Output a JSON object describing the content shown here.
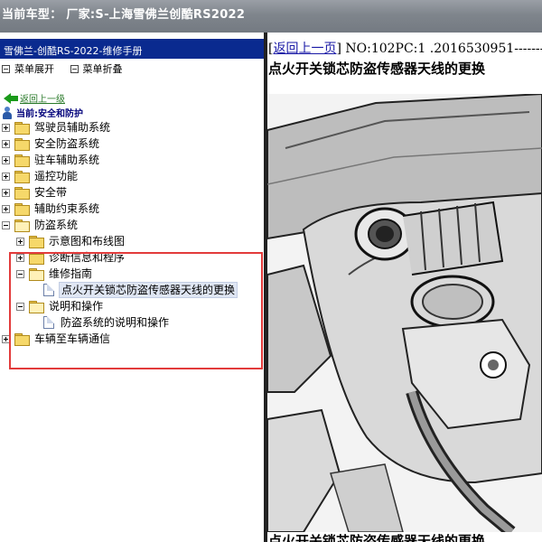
{
  "window": {
    "title": "当前车型：  厂家:S-上海雪佛兰创酷RS2022"
  },
  "left": {
    "header": "雪佛兰-创酷RS-2022-维修手册",
    "tools": {
      "expand_label": "菜单展开",
      "collapse_label": "菜单折叠"
    },
    "back_label": "返回上一级",
    "current_label": "当前:安全和防护"
  },
  "tree": {
    "items": [
      {
        "label": "驾驶员辅助系统",
        "expander": "plus",
        "icon": "folder",
        "level": 0
      },
      {
        "label": "安全防盗系统",
        "expander": "plus",
        "icon": "folder",
        "level": 0
      },
      {
        "label": "驻车辅助系统",
        "expander": "plus",
        "icon": "folder",
        "level": 0
      },
      {
        "label": "遥控功能",
        "expander": "plus",
        "icon": "folder",
        "level": 0
      },
      {
        "label": "安全带",
        "expander": "plus",
        "icon": "folder",
        "level": 0
      },
      {
        "label": "辅助约束系统",
        "expander": "plus",
        "icon": "folder",
        "level": 0
      },
      {
        "label": "防盗系统",
        "expander": "minus",
        "icon": "folder-open",
        "level": 0
      },
      {
        "label": "示意图和布线图",
        "expander": "plus",
        "icon": "folder",
        "level": 1
      },
      {
        "label": "诊断信息和程序",
        "expander": "plus",
        "icon": "folder",
        "level": 1
      },
      {
        "label": "维修指南",
        "expander": "minus",
        "icon": "folder-open",
        "level": 1
      },
      {
        "label": "点火开关锁芯防盗传感器天线的更换",
        "expander": "none",
        "icon": "document",
        "level": 2,
        "selected": true
      },
      {
        "label": "说明和操作",
        "expander": "minus",
        "icon": "folder-open",
        "level": 1
      },
      {
        "label": "防盗系统的说明和操作",
        "expander": "none",
        "icon": "document",
        "level": 2
      },
      {
        "label": "车辆至车辆通信",
        "expander": "plus",
        "icon": "folder",
        "level": 0
      }
    ]
  },
  "right": {
    "back_link": "返回上一页",
    "meta": " NO:102PC:1 .2016530951-------",
    "title": "点火开关锁芯防盗传感器天线的更换",
    "title_repeat": "点火开关锁芯防盗传感器天线的更换"
  },
  "colors": {
    "highlight_box": "#e23b3b",
    "header_bg": "#0a2a8f",
    "titlebar_bg": "#7f858c"
  }
}
